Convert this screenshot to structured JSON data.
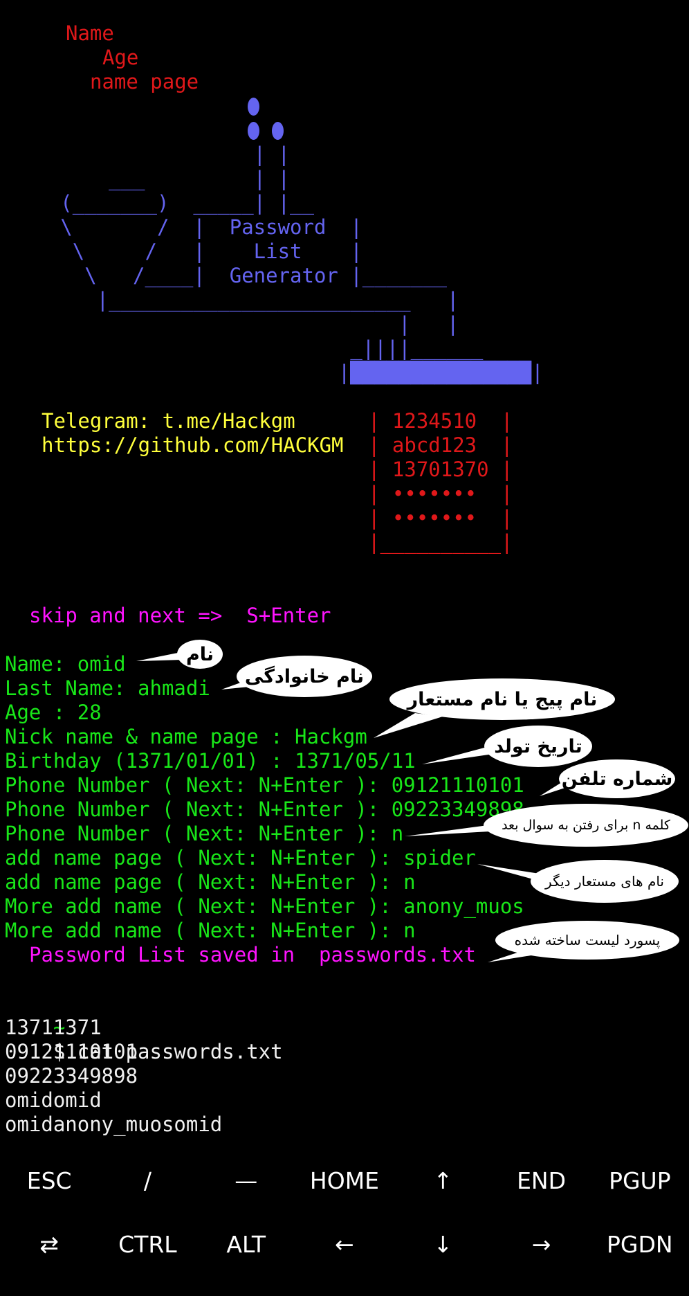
{
  "banner": {
    "label_lines": [
      "Name",
      "Age",
      "name page"
    ],
    "art_lines": [
      "         ___",
      "     (_______)  _____| |__",
      "     \\       /  |  Password  |",
      "      \\     /   |    List    |",
      "       \\   /____|  Generator |_______",
      "        |_________________________   |",
      "                                 |   |",
      "                             _||||______",
      "                            |███████████████|"
    ],
    "pipe_lines": [
      "                     | |",
      "                     | |"
    ],
    "telegram": "Telegram: t.me/Hackgm",
    "github": "https://github.com/HACKGM",
    "box_lines": [
      "| 1234510  |",
      "| abcd123  |",
      "| 13701370 |",
      "| •••••••  |",
      "| •••••••  |",
      "|__________|"
    ]
  },
  "skip_hint": "skip and next =>  S+Enter",
  "inputs": [
    "Name: omid",
    "Last Name: ahmadi",
    "Age : 28",
    "Nick name & name page : Hackgm",
    "Birthday (1371/01/01) : 1371/05/11",
    "Phone Number ( Next: N+Enter ): 09121110101",
    "Phone Number ( Next: N+Enter ): 09223349898",
    "Phone Number ( Next: N+Enter ): n",
    "add name page ( Next: N+Enter ): spider",
    "add name page ( Next: N+Enter ): n",
    "More add name ( Next: N+Enter ): anony_muos",
    "More add name ( Next: N+Enter ): n"
  ],
  "saved_message": "Password List saved in  passwords.txt",
  "command": {
    "tilde": "~",
    "text": "$ cat passwords.txt"
  },
  "output_lines": [
    "13711371",
    "09121110101",
    "09223349898",
    "omidomid",
    "omidanony_muosomid"
  ],
  "callouts": [
    "نام",
    "نام خانوادگی",
    "نام پیج یا نام مستعار",
    "تاریخ تولد",
    "شماره تلفن",
    "کلمه n برای رفتن به سوال بعد",
    "نام های مستعار دیگر",
    "پسورد لیست ساخته شده"
  ],
  "extra_keys": {
    "row1": [
      "ESC",
      "/",
      "—",
      "HOME",
      "↑",
      "END",
      "PGUP"
    ],
    "row2": [
      "⇄",
      "CTRL",
      "ALT",
      "←",
      "↓",
      "→",
      "PGDN"
    ]
  },
  "colors": {
    "background": "#000000",
    "banner_text": "#e0181a",
    "ascii_art": "#6464f0",
    "links": "#ffff3c",
    "highlight": "#ff14ff",
    "prompt_text": "#19e619",
    "output_text": "#f0f0f0"
  }
}
